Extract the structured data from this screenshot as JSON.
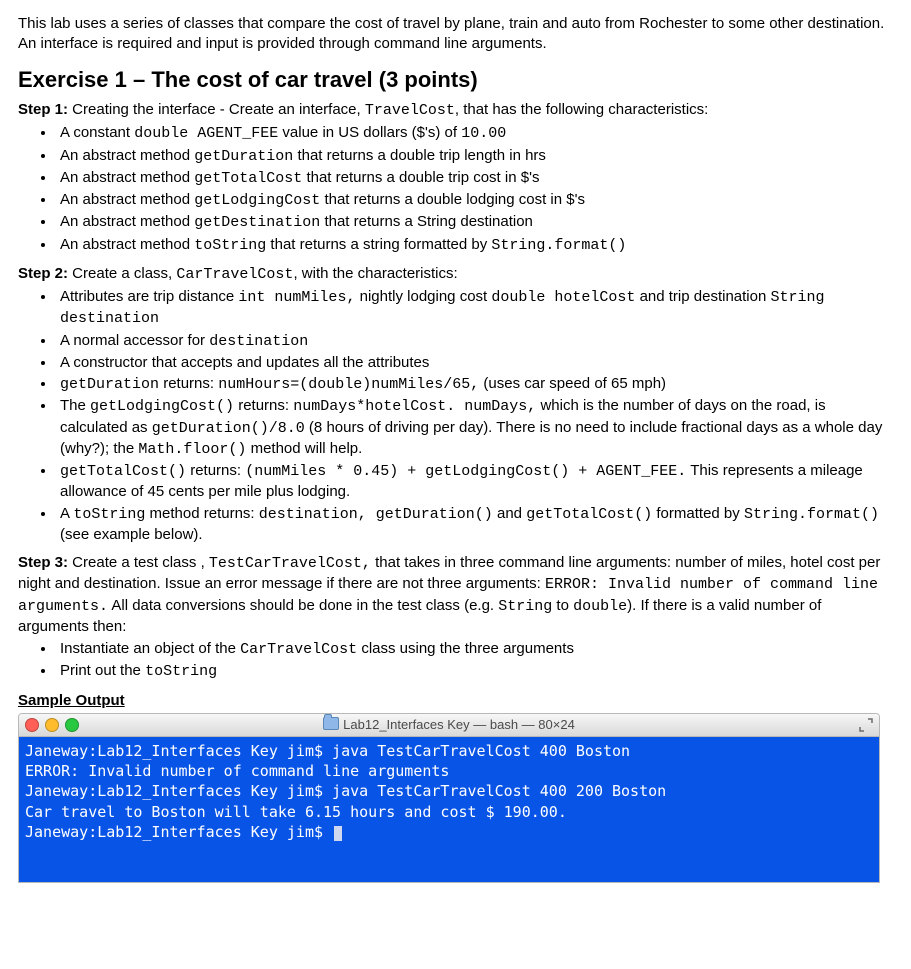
{
  "intro": "This lab uses a series of classes that compare the cost of travel by plane, train and auto from Rochester to some other destination.  An interface is required and input is provided through command line arguments.",
  "ex_title": "Exercise 1 – The cost of car travel  (3 points)",
  "step1": {
    "label": "Step 1:",
    "text_a": " Creating the interface - Create an interface, ",
    "code_a": "TravelCost",
    "text_b": ", that has the following characteristics:",
    "items": {
      "i0": {
        "a": "A constant ",
        "c1": "double AGENT_FEE",
        "b": " value in US dollars ($'s) of ",
        "c2": "10.00"
      },
      "i1": {
        "a": "An abstract method ",
        "c1": "getDuration",
        "b": " that returns a double trip length in hrs"
      },
      "i2": {
        "a": "An abstract method ",
        "c1": "getTotalCost",
        "b": " that returns a double trip cost in $'s"
      },
      "i3": {
        "a": "An abstract method ",
        "c1": "getLodgingCost",
        "b": " that returns a double lodging cost in $'s"
      },
      "i4": {
        "a": "An abstract method ",
        "c1": "getDestination",
        "b": " that returns a String destination"
      },
      "i5": {
        "a": "An abstract method ",
        "c1": "toString",
        "b": " that returns a string formatted by ",
        "c2": "String.format()"
      }
    }
  },
  "step2": {
    "label": "Step 2:",
    "text_a": " Create a class, ",
    "code_a": "CarTravelCost",
    "text_b": ", with the characteristics:",
    "items": {
      "i0": {
        "a": "Attributes are trip distance ",
        "c1": "int numMiles,",
        "b": "  nightly lodging cost ",
        "c2": "double hotelCost",
        "c": " and trip destination ",
        "c3": "String destination"
      },
      "i1": {
        "a": "A normal accessor for ",
        "c1": "destination"
      },
      "i2": {
        "a": "A constructor that accepts and updates all the attributes"
      },
      "i3": {
        "c1": "getDuration",
        "a": " returns: ",
        "c2": "numHours=(double)numMiles/65,",
        "b": " (uses car speed of 65 mph)"
      },
      "i4": {
        "a": "The ",
        "c1": "getLodgingCost()",
        "b": " returns: ",
        "c2": "numDays*hotelCost. numDays,",
        "c": "  which is the number of days on the road, is calculated as ",
        "c3": "getDuration()/8.0",
        "d": " (8 hours of driving per day).  There is no need to include fractional days as a whole day (why?); the ",
        "c4": "Math.floor()",
        "e": " method will help."
      },
      "i5": {
        "c1": "getTotalCost()",
        "a": " returns: ",
        "c2": "(numMiles * 0.45) + getLodgingCost() + AGENT_FEE.",
        "b": " This represents a mileage allowance of 45 cents per mile plus lodging."
      },
      "i6": {
        "a": "A ",
        "c1": "toString",
        "b": " method returns: ",
        "c2": "destination, getDuration()",
        "c": " and ",
        "c3": "getTotalCost()",
        "d": " formatted by ",
        "c4": "String.format()",
        "e": " (see example below)."
      }
    }
  },
  "step3": {
    "label": "Step 3:",
    "text_a": " Create a test class , ",
    "code_a": "TestCarTravelCost,",
    "text_b": " that takes in three command line arguments: number of miles, hotel cost per night and destination. Issue an error message if there are not three arguments: ",
    "code_b": "ERROR: Invalid number of command line arguments.",
    "text_c": " All data conversions should be done in the test class (e.g. ",
    "code_c": "String",
    "text_d": " to ",
    "code_d": "double",
    "text_e": "). If there is a valid number of arguments then:",
    "items": {
      "i0": {
        "a": "Instantiate an object of the ",
        "c1": "CarTravelCost",
        "b": " class using the three arguments"
      },
      "i1": {
        "a": "Print out the ",
        "c1": "toString"
      }
    }
  },
  "sample_label": "Sample Output",
  "terminal": {
    "title": "Lab12_Interfaces Key — bash — 80×24",
    "lines": {
      "l0": "Janeway:Lab12_Interfaces Key jim$ java TestCarTravelCost 400 Boston",
      "l1": "ERROR: Invalid number of command line arguments",
      "l2": "Janeway:Lab12_Interfaces Key jim$ java TestCarTravelCost 400 200 Boston",
      "l3": "Car travel to Boston will take 6.15 hours and cost $ 190.00.",
      "l4": "Janeway:Lab12_Interfaces Key jim$ "
    }
  }
}
